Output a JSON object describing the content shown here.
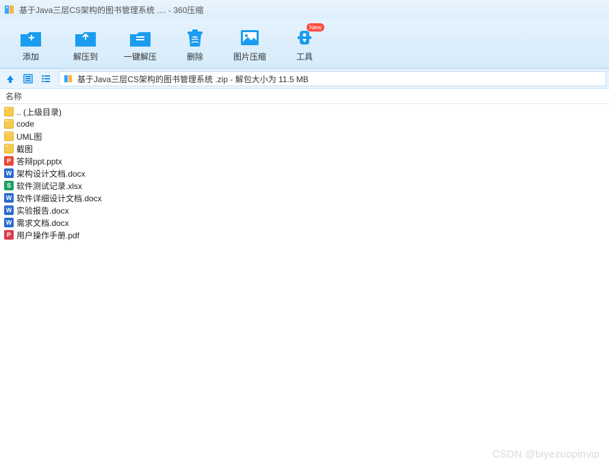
{
  "titlebar": {
    "title": "基于Java三层CS架构的图书管理系统 .... - 360压缩"
  },
  "toolbar": {
    "items": [
      {
        "key": "add",
        "label": "添加",
        "icon": "add-icon"
      },
      {
        "key": "extract_to",
        "label": "解压到",
        "icon": "extract-icon"
      },
      {
        "key": "one_click",
        "label": "一键解压",
        "icon": "oneclick-icon"
      },
      {
        "key": "delete",
        "label": "删除",
        "icon": "delete-icon"
      },
      {
        "key": "image_compress",
        "label": "图片压缩",
        "icon": "image-compress-icon"
      },
      {
        "key": "tools",
        "label": "工具",
        "icon": "tools-icon",
        "badge": "New"
      }
    ]
  },
  "pathbar": {
    "archive_name": "基于Java三层CS架构的图书管理系统 .zip",
    "separator": " - ",
    "size_prefix": "解包大小为 ",
    "size_value": "11.5 MB"
  },
  "columns": {
    "name": "名称"
  },
  "files": [
    {
      "type": "folder",
      "name": ".. (上级目录)"
    },
    {
      "type": "folder",
      "name": "code"
    },
    {
      "type": "folder",
      "name": "UML图"
    },
    {
      "type": "folder",
      "name": "截图"
    },
    {
      "type": "pptx",
      "name": "答辩ppt.pptx"
    },
    {
      "type": "docx",
      "name": "架构设计文档.docx"
    },
    {
      "type": "xlsx",
      "name": "软件测试记录.xlsx"
    },
    {
      "type": "docx",
      "name": "软件详细设计文档.docx"
    },
    {
      "type": "docx",
      "name": "实验报告.docx"
    },
    {
      "type": "docx",
      "name": "需求文档.docx"
    },
    {
      "type": "pdf",
      "name": "用户操作手册.pdf"
    }
  ],
  "watermark": "CSDN @biyezuopinvip"
}
